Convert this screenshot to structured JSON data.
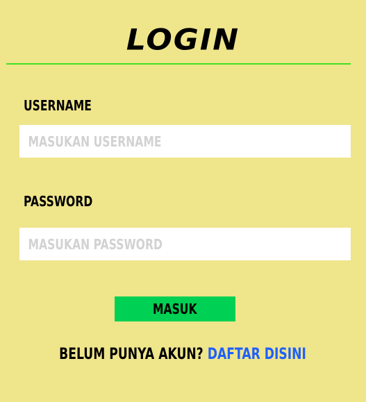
{
  "title": "LOGIN",
  "form": {
    "username": {
      "label": "USERNAME",
      "value": "",
      "placeholder": "MASUKAN USERNAME"
    },
    "password": {
      "label": "PASSWORD",
      "value": "",
      "placeholder": "MASUKAN PASSWORD"
    },
    "submit_label": "MASUK"
  },
  "footer": {
    "question": "BELUM PUNYA AKUN?",
    "register_link": "DAFTAR DISINI"
  },
  "colors": {
    "background": "#efe58b",
    "divider": "#3fe023",
    "button": "#00d053",
    "link": "#1f5fff",
    "placeholder": "#d2d2d2"
  }
}
